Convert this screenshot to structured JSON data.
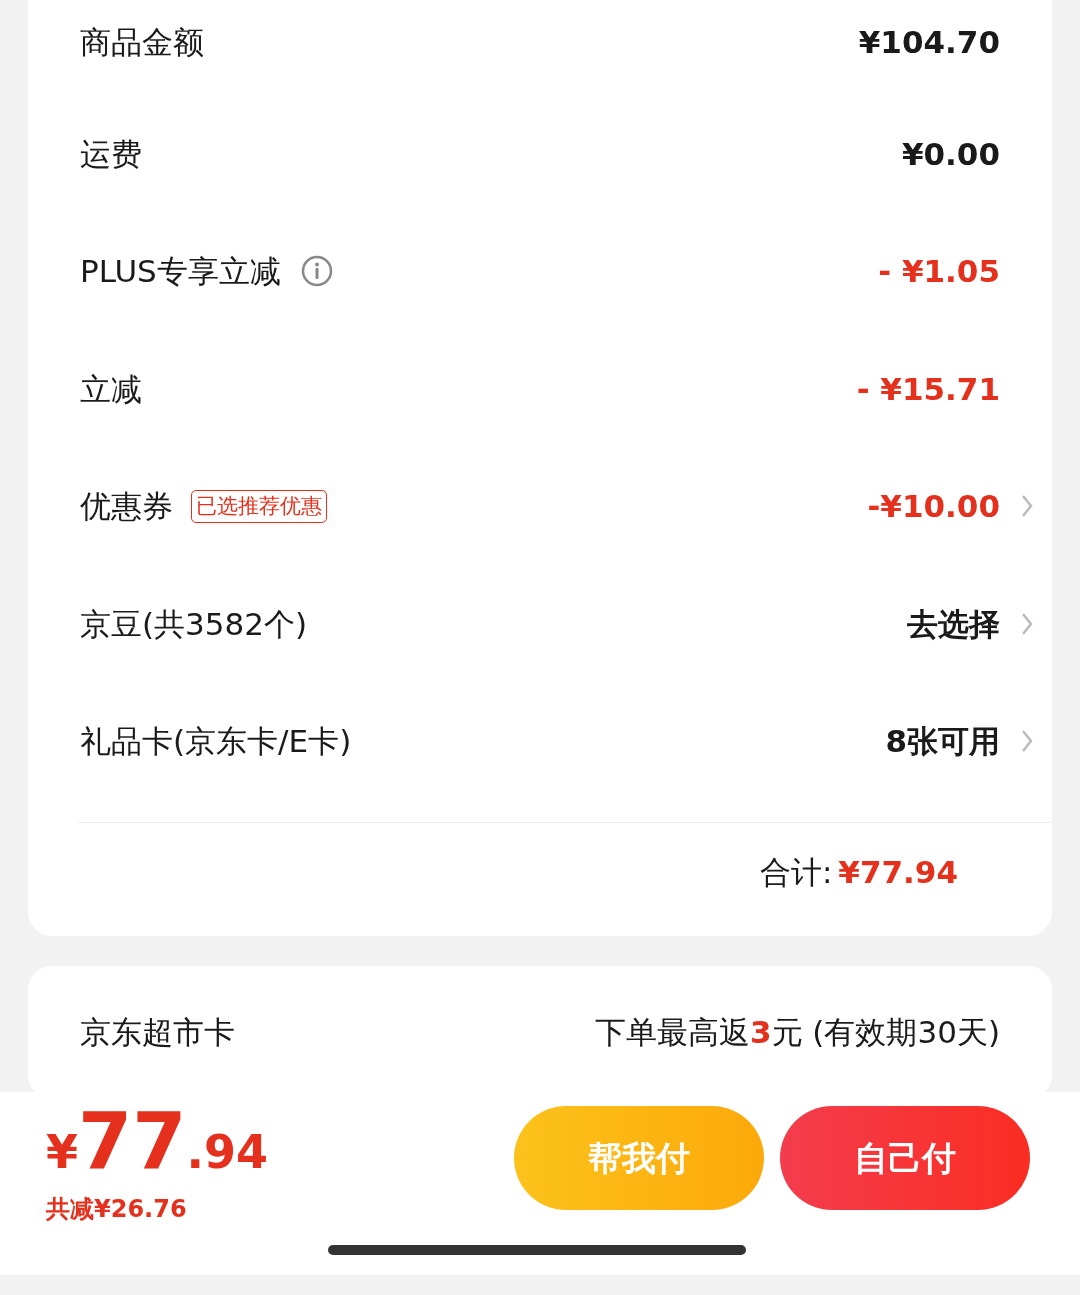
{
  "summary": {
    "rows": [
      {
        "label": "商品金额",
        "value": "¥104.70",
        "discount": false,
        "info": false,
        "chevron": false
      },
      {
        "label": "运费",
        "value": "¥0.00",
        "discount": false,
        "info": false,
        "chevron": false
      },
      {
        "label": "PLUS专享立减",
        "value": "- ¥1.05",
        "discount": true,
        "info": true,
        "chevron": false
      },
      {
        "label": "立减",
        "value": "- ¥15.71",
        "discount": true,
        "info": false,
        "chevron": false
      },
      {
        "label": "优惠券",
        "tag": "已选推荐优惠",
        "value": "-¥10.00",
        "discount": true,
        "info": false,
        "chevron": true
      },
      {
        "label": "京豆(共3582个)",
        "value": "去选择",
        "discount": false,
        "info": false,
        "chevron": true
      },
      {
        "label": "礼品卡(京东卡/E卡)",
        "value": "8张可用",
        "discount": false,
        "info": false,
        "chevron": true
      }
    ],
    "total_label": "合计:",
    "total_value": "¥77.94"
  },
  "card_offer": {
    "label": "京东超市卡",
    "benefit": "下单最高返**3**元 (有效期30天)"
  },
  "footer": {
    "currency": "¥",
    "integer": "77",
    "decimal": ".94",
    "saved": "共减¥26.76",
    "buttons": [
      {
        "label": "帮我付",
        "kind": "friend"
      },
      {
        "label": "自己付",
        "kind": "self"
      }
    ]
  }
}
